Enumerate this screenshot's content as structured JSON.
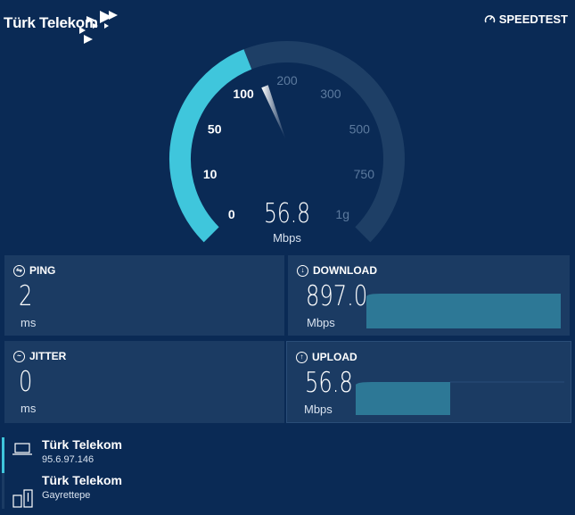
{
  "brand": {
    "logo_text": "Türk Telekom",
    "speedtest_label": "SPEEDTEST"
  },
  "gauge": {
    "value": "56.8",
    "unit": "Mbps",
    "fraction": 0.42,
    "scale_labels": [
      "0",
      "10",
      "50",
      "100",
      "200",
      "300",
      "500",
      "750",
      "1g"
    ],
    "active_label": "50",
    "colors": {
      "track": "#1e3f66",
      "fill": "#3fc6dc",
      "needle": "#ffffff"
    }
  },
  "ping": {
    "title": "PING",
    "value": "2",
    "unit": "ms",
    "icon": "ping-icon"
  },
  "jitter": {
    "title": "JITTER",
    "value": "0",
    "unit": "ms",
    "icon": "jitter-icon"
  },
  "download": {
    "title": "DOWNLOAD",
    "value": "897.0",
    "unit": "Mbps",
    "icon": "download-arrow-icon"
  },
  "upload": {
    "title": "UPLOAD",
    "value": "56.8",
    "unit": "Mbps",
    "icon": "upload-arrow-icon"
  },
  "servers": [
    {
      "name": "Türk Telekom",
      "detail": "95.6.97.146",
      "icon": "laptop-icon",
      "active": true
    },
    {
      "name": "Türk Telekom",
      "detail": "Gayrettepe",
      "icon": "server-icon",
      "active": false
    }
  ],
  "colors": {
    "bg": "#0a2a55",
    "card": "#1b3b63",
    "accent": "#3fc6dc",
    "chart_fill": "#2d7896"
  }
}
